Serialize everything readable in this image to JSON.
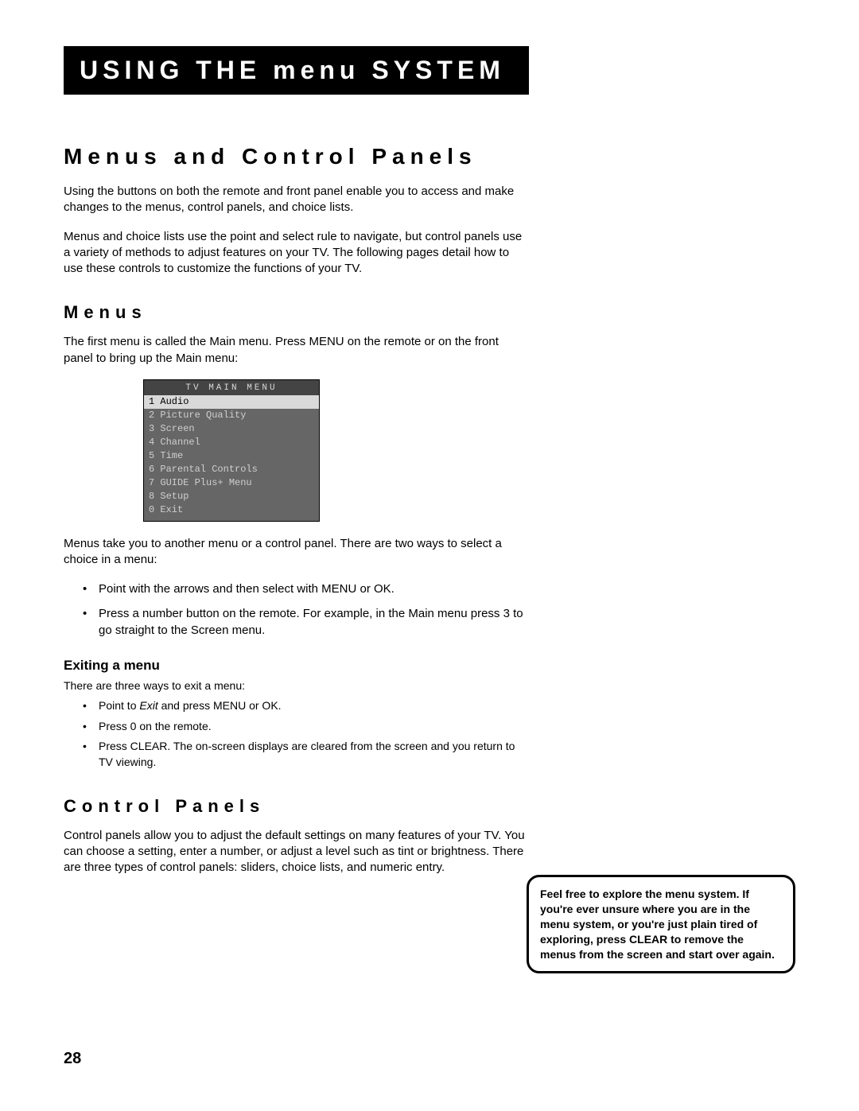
{
  "title_bar": "USING THE menu SYSTEM",
  "h1": "Menus and Control Panels",
  "intro_p1": "Using the buttons on both the remote and front panel enable you to access and make changes to the menus, control panels, and choice lists.",
  "intro_p2": "Menus and choice lists use the point and select rule to navigate, but control panels use a variety of methods to adjust features on your TV. The following pages detail how to use these controls to customize the functions of your TV.",
  "h2_menus": "Menus",
  "menus_p1": "The first menu is called the Main menu. Press MENU on the remote or on the front panel to bring up the Main menu:",
  "menu_shot": {
    "title": "TV MAIN MENU",
    "rows": [
      {
        "num": "1",
        "label": "Audio",
        "selected": true
      },
      {
        "num": "2",
        "label": "Picture Quality",
        "selected": false
      },
      {
        "num": "3",
        "label": "Screen",
        "selected": false
      },
      {
        "num": "4",
        "label": "Channel",
        "selected": false
      },
      {
        "num": "5",
        "label": "Time",
        "selected": false
      },
      {
        "num": "6",
        "label": "Parental Controls",
        "selected": false
      },
      {
        "num": "7",
        "label": "GUIDE Plus+ Menu",
        "selected": false
      },
      {
        "num": "8",
        "label": "Setup",
        "selected": false
      },
      {
        "num": "0",
        "label": "Exit",
        "selected": false
      }
    ]
  },
  "menus_p2": "Menus take you to another menu or a control panel. There are two ways to select a choice in a menu:",
  "menus_bullets": [
    "Point with the arrows and then select with MENU or OK.",
    "Press a number button on the remote. For example, in the Main menu press 3 to go straight to the Screen menu."
  ],
  "h3_exit": "Exiting a menu",
  "exit_p1": "There are three ways to exit a menu:",
  "exit_bullets_pre": "Point to ",
  "exit_bullets_it": "Exit",
  "exit_bullets_post": " and press MENU or OK.",
  "exit_bullets": [
    "Press 0 on the remote.",
    "Press CLEAR. The on-screen displays are cleared from the screen and you return to TV viewing."
  ],
  "h2_cp": "Control Panels",
  "cp_p1": "Control panels allow you to adjust the default settings on many features of your TV. You can choose a setting, enter a number, or adjust a level such as tint or brightness. There are three types of control panels: sliders, choice lists, and numeric entry.",
  "tip": "Feel free to explore the menu system. If you're ever unsure where you are in the menu system, or you're just plain tired of exploring, press CLEAR to remove the menus from the screen and start over again.",
  "page_number": "28"
}
